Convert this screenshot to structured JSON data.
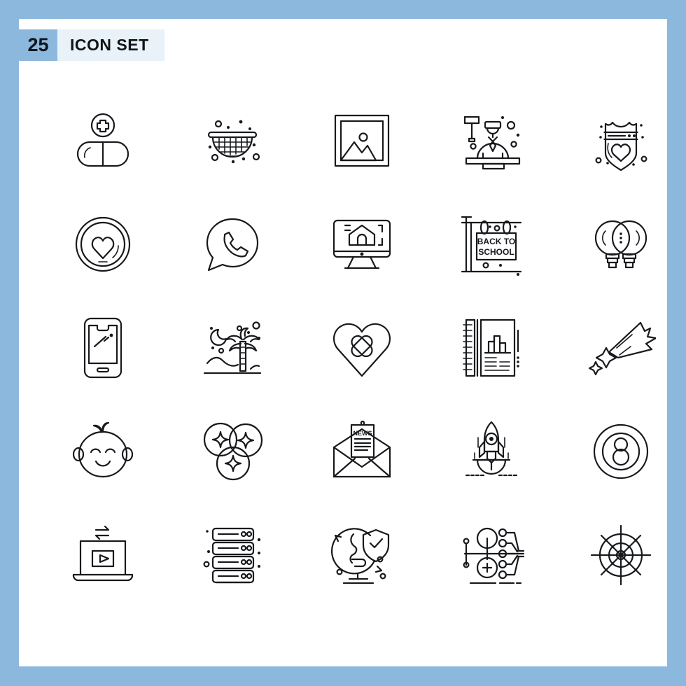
{
  "poster": {
    "border_color": "#8cb8dd",
    "canvas_color": "#ffffff",
    "stroke_color": "#17191c",
    "badge_bg": "#8cb8dd",
    "title_bg": "#e9f1f9"
  },
  "header": {
    "count": "25",
    "title": "ICON SET"
  },
  "grid": {
    "rows": 5,
    "columns": 5,
    "total": 25
  },
  "icons": [
    {
      "index": 1,
      "name": "pill-medical-icon",
      "label": "Pill with medical plus"
    },
    {
      "index": 2,
      "name": "strainer-colander-icon",
      "label": "Strainer"
    },
    {
      "index": 3,
      "name": "picture-frame-icon",
      "label": "Picture"
    },
    {
      "index": 4,
      "name": "judge-gavel-icon",
      "label": "Judge"
    },
    {
      "index": 5,
      "name": "police-badge-heart-icon",
      "label": "Badge with heart"
    },
    {
      "index": 6,
      "name": "heart-circle-icon",
      "label": "Heart in circle"
    },
    {
      "index": 7,
      "name": "whatsapp-call-bubble-icon",
      "label": "Phone chat bubble"
    },
    {
      "index": 8,
      "name": "monitor-house-icon",
      "label": "Online real estate"
    },
    {
      "index": 9,
      "name": "back-to-school-sign-icon",
      "label": "Back to school sign",
      "text": [
        "BACK TO",
        "SCHOOL"
      ]
    },
    {
      "index": 10,
      "name": "two-light-bulbs-icon",
      "label": "Light bulbs"
    },
    {
      "index": 11,
      "name": "smartphone-icon",
      "label": "Smartphone"
    },
    {
      "index": 12,
      "name": "palm-tree-night-icon",
      "label": "Palm tree at night"
    },
    {
      "index": 13,
      "name": "heart-bandage-icon",
      "label": "Heart with bandages"
    },
    {
      "index": 14,
      "name": "notebook-report-icon",
      "label": "Notebook report"
    },
    {
      "index": 15,
      "name": "shooting-star-icon",
      "label": "Shooting star"
    },
    {
      "index": 16,
      "name": "baby-face-icon",
      "label": "Baby"
    },
    {
      "index": 17,
      "name": "sparkle-bubbles-icon",
      "label": "Sparkling bubbles"
    },
    {
      "index": 18,
      "name": "news-envelope-icon",
      "label": "Newsletter",
      "text": [
        "NEWS"
      ]
    },
    {
      "index": 19,
      "name": "rocket-bowl-icon",
      "label": "Rocket launch"
    },
    {
      "index": 20,
      "name": "eight-ball-icon",
      "label": "Eight ball"
    },
    {
      "index": 21,
      "name": "laptop-video-transfer-icon",
      "label": "Laptop video transfer"
    },
    {
      "index": 22,
      "name": "server-stack-icon",
      "label": "Server stack"
    },
    {
      "index": 23,
      "name": "globe-shield-icon",
      "label": "Global security"
    },
    {
      "index": 24,
      "name": "network-circuit-icon",
      "label": "Network circuit"
    },
    {
      "index": 25,
      "name": "ship-wheel-target-icon",
      "label": "Ship wheel"
    }
  ]
}
